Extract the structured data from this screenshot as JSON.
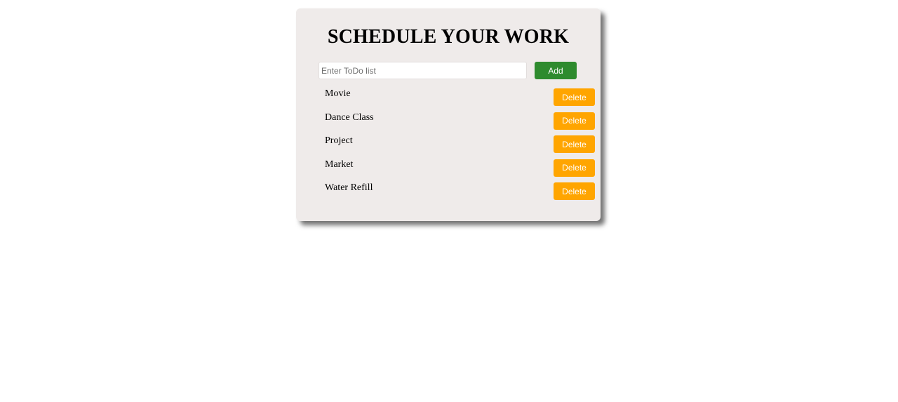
{
  "header": {
    "title": "SCHEDULE YOUR WORK"
  },
  "form": {
    "input_value": "",
    "input_placeholder": "Enter ToDo list",
    "add_label": "Add"
  },
  "todos": [
    {
      "text": "Movie",
      "delete_label": "Delete"
    },
    {
      "text": "Dance Class",
      "delete_label": "Delete"
    },
    {
      "text": "Project",
      "delete_label": "Delete"
    },
    {
      "text": "Market",
      "delete_label": "Delete"
    },
    {
      "text": "Water Refill",
      "delete_label": "Delete"
    }
  ],
  "colors": {
    "card_background": "#efebea",
    "add_button": "#2e8b2e",
    "delete_button": "#ffa500"
  }
}
